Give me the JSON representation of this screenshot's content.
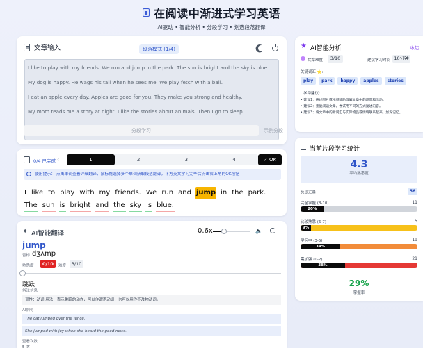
{
  "header": {
    "title": "在阅读中渐进式学习英语",
    "subtitle": "AI驱动 • 智能分析 • 分段学习 • 划选段落翻译"
  },
  "input_card": {
    "title": "文章输入",
    "mode_badge": "段落模式 (1/4)",
    "paragraphs": [
      "I like to play with my friends. We run and jump in the park. The sun is bright and the sky is blue.",
      "My dog is happy. He wags his tall when he sees me. We play fetch with a ball.",
      "I eat an apple every day. Apples are good for you. They make you strong and healthy.",
      "My mom reads me a story at night. I like the stories about animals. Then I go to sleep."
    ],
    "split_button": "分段学习",
    "example_button": "示例分段"
  },
  "reader_card": {
    "progress": "0/4 已完成",
    "tabs": [
      "1",
      "2",
      "3",
      "4"
    ],
    "active_tab": 0,
    "ok_button": "OK",
    "hint": "使用提示：  点击单词查看详细翻译，鼠标拖选择多个单词获取段落翻译，下方英文学习完毕后点击右上角的OK按钮",
    "words": [
      {
        "t": "I",
        "c": "none"
      },
      {
        "t": "like",
        "c": "green"
      },
      {
        "t": "to",
        "c": "green"
      },
      {
        "t": "play",
        "c": "red"
      },
      {
        "t": "with",
        "c": "green"
      },
      {
        "t": "my",
        "c": "green"
      },
      {
        "t": "friends.",
        "c": "green"
      },
      {
        "t": "We",
        "c": "none"
      },
      {
        "t": "run",
        "c": "red"
      },
      {
        "t": "and",
        "c": "green"
      },
      {
        "t": "jump",
        "c": "sel"
      },
      {
        "t": "in",
        "c": "green"
      },
      {
        "t": "the",
        "c": "green"
      },
      {
        "t": "park.",
        "c": "red"
      },
      {
        "t": "The",
        "c": "green"
      },
      {
        "t": "sun",
        "c": "red"
      },
      {
        "t": "is",
        "c": "green"
      },
      {
        "t": "bright",
        "c": "red"
      },
      {
        "t": "and",
        "c": "red"
      },
      {
        "t": "the",
        "c": "green"
      },
      {
        "t": "sky",
        "c": "green"
      },
      {
        "t": "is",
        "c": "green"
      },
      {
        "t": "blue.",
        "c": "red"
      }
    ]
  },
  "translate_card": {
    "title": "AI智能翻译",
    "speed": "0.6x",
    "speed_fraction": 0.3,
    "word": "jump",
    "phonetic_label": "音标",
    "phonetic": "dʒʌmp",
    "familiarity_label": "熟悉度",
    "familiarity": "0/10",
    "familiarity_fraction": 0,
    "difficulty_label": "难度",
    "difficulty": "3/10",
    "meaning": "跳跃",
    "meaning_sub": "俗法信息",
    "usage": "词性：动词  用法：表示跳跃的动作，可以作谓语动词，也可以用作不及物动词。",
    "examples_label": "AI例句",
    "examples": [
      "The cat jumped over the fence.",
      "She jumped with joy when she heard the good news."
    ],
    "count_label": "查看次数",
    "count": "5 次"
  },
  "ai_card": {
    "title": "AI智能分析",
    "close": "收起",
    "difficulty_label": "文章难度",
    "difficulty": "3/10",
    "time_label": "建议学习时间",
    "time": "10分钟",
    "keywords_label": "关键词汇 ⭐:",
    "keywords": [
      "play",
      "park",
      "happy",
      "apples",
      "stories"
    ],
    "tips_label": "学习建议:",
    "tips": [
      "• 建议1：通过图片或视频辅助理解文章中的场景和活动。",
      "• 建议2：重复阅读文章，尝试用不同的方式复述内容。",
      "• 建议3：将文章中的新词汇与实际物品或情境联系起来，加深记忆。"
    ]
  },
  "stats_card": {
    "title": "当前片段学习统计",
    "average": "4.3",
    "average_label": "平均熟悉度",
    "total_label": "总词汇量",
    "total": "56",
    "rows": [
      {
        "label": "完全掌握 (8-10)",
        "count": "11",
        "pct": "20%",
        "fill": 0.2,
        "color": "#d1d5db"
      },
      {
        "label": "比较熟悉 (6-7)",
        "count": "5",
        "pct": "9%",
        "fill": 0.09,
        "color": "#f7c11a"
      },
      {
        "label": "学习中 (3-5)",
        "count": "19",
        "pct": "34%",
        "fill": 0.34,
        "color": "#f28c3a"
      },
      {
        "label": "需加强 (0-2)",
        "count": "21",
        "pct": "38%",
        "fill": 0.38,
        "color": "#e53935"
      }
    ],
    "mastery": "29%",
    "mastery_label": "掌握率"
  }
}
